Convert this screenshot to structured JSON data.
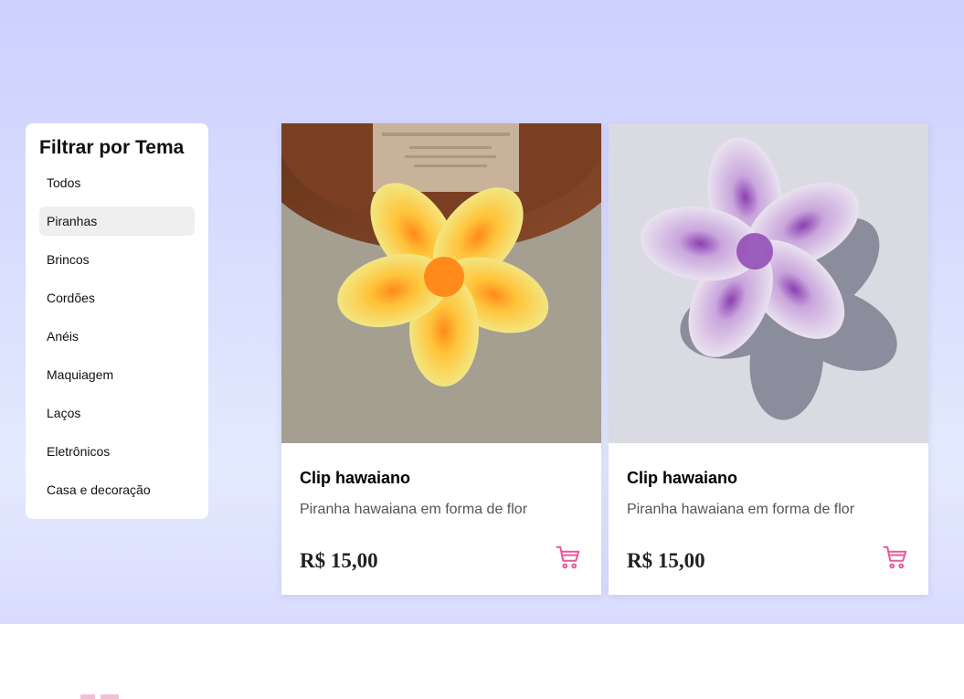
{
  "sidebar": {
    "title": "Filtrar por Tema",
    "items": [
      {
        "label": "Todos",
        "active": false
      },
      {
        "label": "Piranhas",
        "active": true
      },
      {
        "label": "Brincos",
        "active": false
      },
      {
        "label": "Cordões",
        "active": false
      },
      {
        "label": "Anéis",
        "active": false
      },
      {
        "label": "Maquiagem",
        "active": false
      },
      {
        "label": "Laços",
        "active": false
      },
      {
        "label": "Eletrônicos",
        "active": false
      },
      {
        "label": "Casa e decoração",
        "active": false
      }
    ]
  },
  "products": [
    {
      "title": "Clip hawaiano",
      "description": "Piranha hawaiana em forma de flor",
      "price": "R$ 15,00",
      "image": "yellow-orange-flower-hair-clip"
    },
    {
      "title": "Clip hawaiano",
      "description": "Piranha hawaiana em forma de flor",
      "price": "R$ 15,00",
      "image": "white-purple-flower-hair-clip"
    }
  ],
  "colors": {
    "accent": "#e8589b",
    "hero_top": "#cdd0fe",
    "hero_bottom": "#e4eafe"
  },
  "icons": [
    "shopping-cart-icon"
  ]
}
